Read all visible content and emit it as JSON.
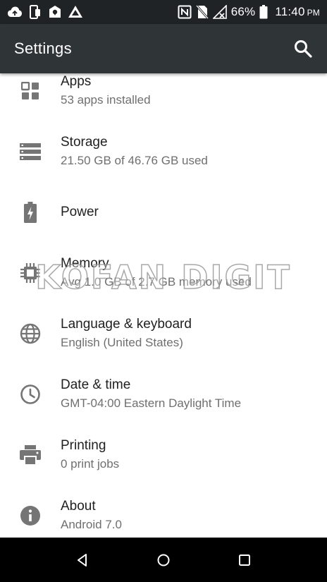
{
  "status_bar": {
    "battery": "66%",
    "time": "11:40",
    "ampm": "PM",
    "icons": [
      "cloud-upload-icon",
      "phone-link-icon",
      "location-pin-icon",
      "drive-icon",
      "nfc-icon",
      "no-sim-icon",
      "no-signal-icon",
      "battery-icon"
    ]
  },
  "app_bar": {
    "title": "Settings",
    "search_icon": "search-icon"
  },
  "settings": {
    "items": [
      {
        "title": "Apps",
        "subtitle": "53 apps installed",
        "icon": "apps-icon"
      },
      {
        "title": "Storage",
        "subtitle": "21.50 GB of 46.76 GB used",
        "icon": "storage-icon"
      },
      {
        "title": "Power",
        "subtitle": "",
        "icon": "battery-charging-icon"
      },
      {
        "title": "Memory",
        "subtitle": "Avg 1.0 GB of 2.7 GB memory used",
        "icon": "memory-icon"
      },
      {
        "title": "Language & keyboard",
        "subtitle": "English (United States)",
        "icon": "globe-icon"
      },
      {
        "title": "Date & time",
        "subtitle": "GMT-04:00 Eastern Daylight Time",
        "icon": "clock-icon"
      },
      {
        "title": "Printing",
        "subtitle": "0 print jobs",
        "icon": "printer-icon"
      },
      {
        "title": "About",
        "subtitle": "Android 7.0",
        "icon": "info-icon"
      }
    ]
  },
  "watermark": {
    "text": "KOFAN DIGIT"
  },
  "nav_bar": {
    "back_icon": "back-icon",
    "home_icon": "home-icon",
    "recents_icon": "recents-icon"
  },
  "colors": {
    "status_bar": "#1f2326",
    "app_bar": "#2f3537",
    "icon_gray": "#757575",
    "title_text": "#212121",
    "subtitle_text": "#6f6f6f"
  }
}
